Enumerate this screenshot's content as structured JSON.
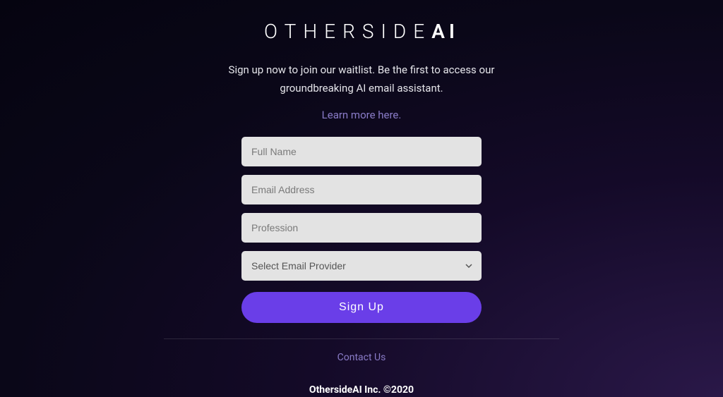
{
  "logo": {
    "part1": "OTHERSIDE",
    "part2": "AI"
  },
  "tagline": "Sign up now to join our waitlist. Be the first to access our groundbreaking AI email assistant.",
  "learn_more": "Learn more here.",
  "form": {
    "full_name_placeholder": "Full Name",
    "email_placeholder": "Email Address",
    "profession_placeholder": "Profession",
    "provider_placeholder": "Select Email Provider",
    "signup_label": "Sign Up"
  },
  "footer": {
    "contact": "Contact Us",
    "copyright": "OthersideAI Inc. ©2020"
  }
}
